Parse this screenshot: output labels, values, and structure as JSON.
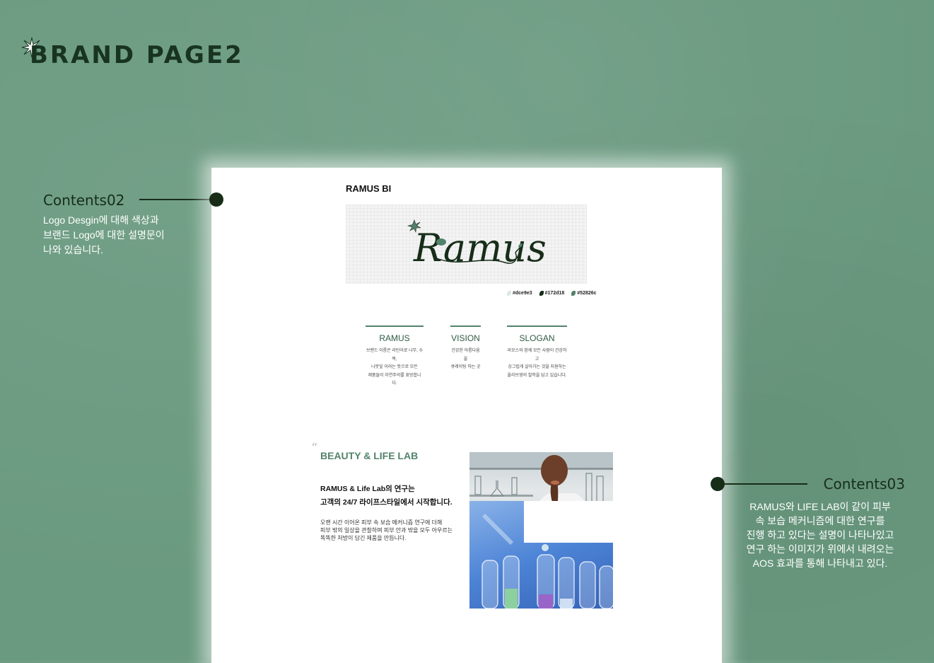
{
  "header": {
    "title": "BRAND PAGE2",
    "star_icon": "star-burst-icon"
  },
  "callouts": {
    "contents02": {
      "heading": "Contents02",
      "lines": [
        "Logo Desgin에 대해 색상과",
        "브랜드 Logo에 대한 설명문이",
        "나와 있습니다."
      ]
    },
    "contents03": {
      "heading": "Contents03",
      "lines": [
        "RAMUS와 LIFE LAB이 같이 피부",
        "속 보습 메커니즘에 대한 연구를",
        "진행 하고 있다는 설명이 나타나있고",
        "연구 하는 이미지가 위에서 내려오는",
        "AOS 효과를 통해 나타내고 있다."
      ]
    }
  },
  "page": {
    "bi_title": "RAMUS BI",
    "logo_text": "Ramus",
    "swatches": [
      {
        "label": "#dce9e3",
        "color": "#dce9e3"
      },
      {
        "label": "#172d18",
        "color": "#172d18"
      },
      {
        "label": "#52826c",
        "color": "#52826c"
      }
    ],
    "columns": [
      {
        "heading": "RAMUS",
        "lines": [
          "브랜드 이름은 라틴어로 나무, 수목,",
          "나뭇잎 이라는 뜻으로 모든",
          "제품들이 자연주의를 표방합니다."
        ]
      },
      {
        "heading": "VISION",
        "lines": [
          "건강한 아름다움을",
          "큐레이팅 하는 곳"
        ]
      },
      {
        "heading": "SLOGAN",
        "lines": [
          "라모스와 함께 모든 사람이 건강하고",
          "싱그럽게 살아가는 것을 지원하는",
          "올리브영의 철학을 담고 있습니다."
        ]
      }
    ],
    "lab": {
      "quote_mark": "“",
      "title": "BEAUTY & LIFE LAB",
      "bold_lines": [
        "RAMUS & Life Lab의 연구는",
        "고객의 24/7 라이프스타일에서 시작합니다."
      ],
      "body_lines": [
        "오랜 시간 이어온 피부 속 보습 메커니즘 연구에 더해",
        "피부 밖의 일상을 관찰하며 피부 안과 밖을 모두 아우르는",
        "똑똑한 처방이 담긴 제품을 만듭니다."
      ]
    }
  }
}
